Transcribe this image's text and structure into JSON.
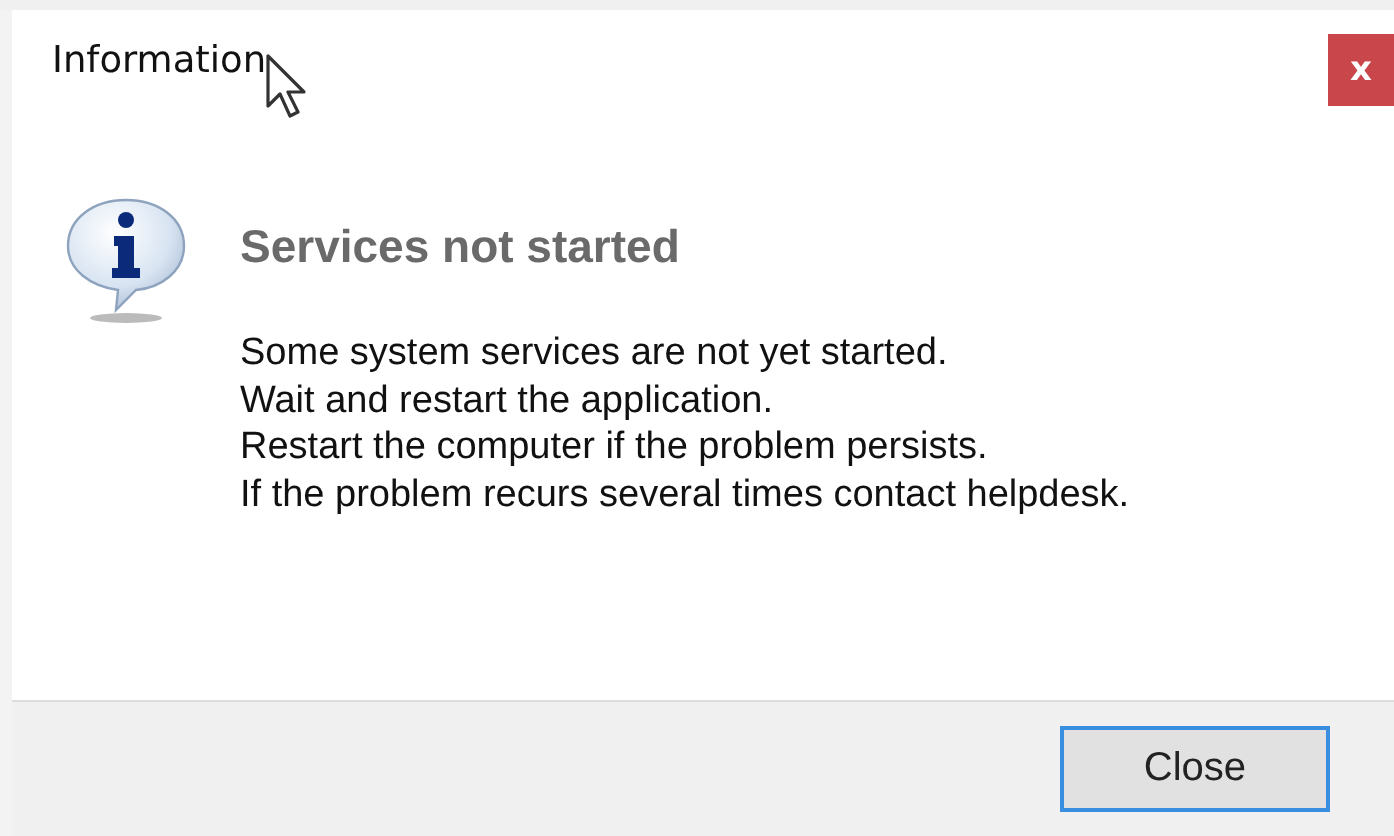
{
  "window": {
    "title": "Information"
  },
  "close_button": "x",
  "heading": "Services not started",
  "message_lines": [
    "Some system services are not yet started.",
    "Wait and restart the application.",
    "Restart the computer if the problem persists.",
    "If the problem recurs several times contact helpdesk."
  ],
  "buttons": [
    "Close"
  ]
}
